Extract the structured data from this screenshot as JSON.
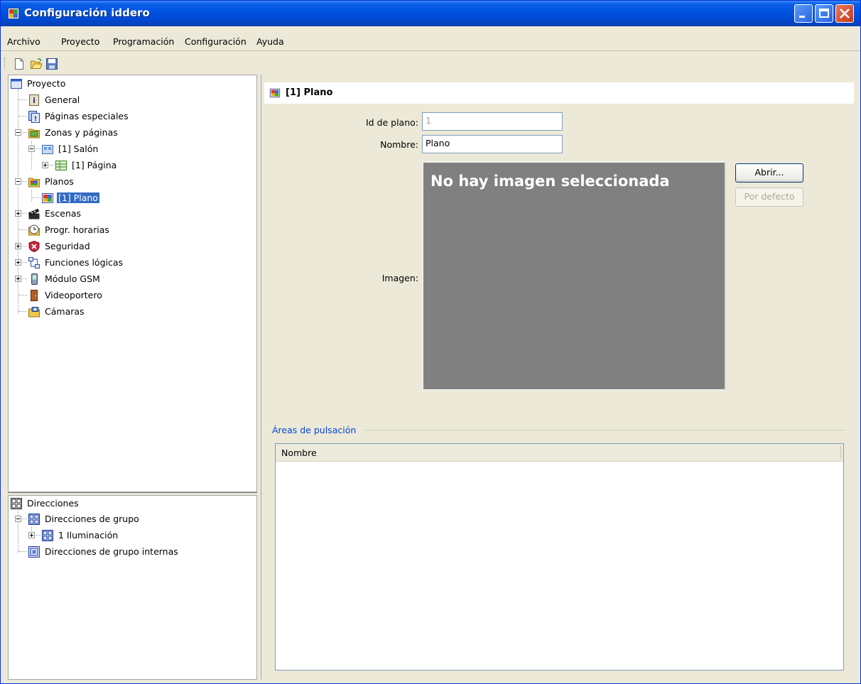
{
  "window": {
    "title": "Configuración iddero"
  },
  "menu": [
    "Archivo",
    "Proyecto",
    "Programación",
    "Configuración",
    "Ayuda"
  ],
  "toolbar": {
    "icons": [
      "new-file-icon",
      "open-folder-icon",
      "save-disk-icon"
    ]
  },
  "project_tree": {
    "root": "Proyecto",
    "items": [
      {
        "label": "General",
        "icon": "info-icon"
      },
      {
        "label": "Páginas especiales",
        "icon": "special-pages-icon"
      },
      {
        "label": "Zonas y páginas",
        "icon": "zones-icon"
      },
      {
        "label": "[1] Salón",
        "icon": "room-icon"
      },
      {
        "label": "[1] Página",
        "icon": "page-icon"
      },
      {
        "label": "Planos",
        "icon": "plans-icon"
      },
      {
        "label": "[1] Plano",
        "icon": "plan-icon",
        "selected": true
      },
      {
        "label": "Escenas",
        "icon": "clapperboard-icon"
      },
      {
        "label": "Progr. horarias",
        "icon": "clock-icon"
      },
      {
        "label": "Seguridad",
        "icon": "shield-icon"
      },
      {
        "label": "Funciones lógicas",
        "icon": "logic-icon"
      },
      {
        "label": "Módulo GSM",
        "icon": "phone-icon"
      },
      {
        "label": "Videoportero",
        "icon": "door-icon"
      },
      {
        "label": "Cámaras",
        "icon": "camera-icon"
      }
    ]
  },
  "address_tree": {
    "root": "Direcciones",
    "items": [
      {
        "label": "Direcciones de grupo",
        "icon": "group-address-icon"
      },
      {
        "label": "1 Iluminación",
        "icon": "group-address-icon"
      },
      {
        "label": "Direcciones de grupo internas",
        "icon": "internal-address-icon"
      }
    ]
  },
  "detail": {
    "header": "[1] Plano",
    "id_label": "Id de plano:",
    "id_value": "1",
    "name_label": "Nombre:",
    "name_value": "Plano",
    "image_label": "Imagen:",
    "image_placeholder": "No hay imagen seleccionada",
    "open_button": "Abrir...",
    "default_button": "Por defecto",
    "areas_title": "Áreas de pulsación",
    "areas_column": "Nombre"
  },
  "colors": {
    "titlebar": "#0054e3",
    "selection": "#316ac5",
    "group_title": "#0046d5",
    "image_bg": "#808080"
  }
}
